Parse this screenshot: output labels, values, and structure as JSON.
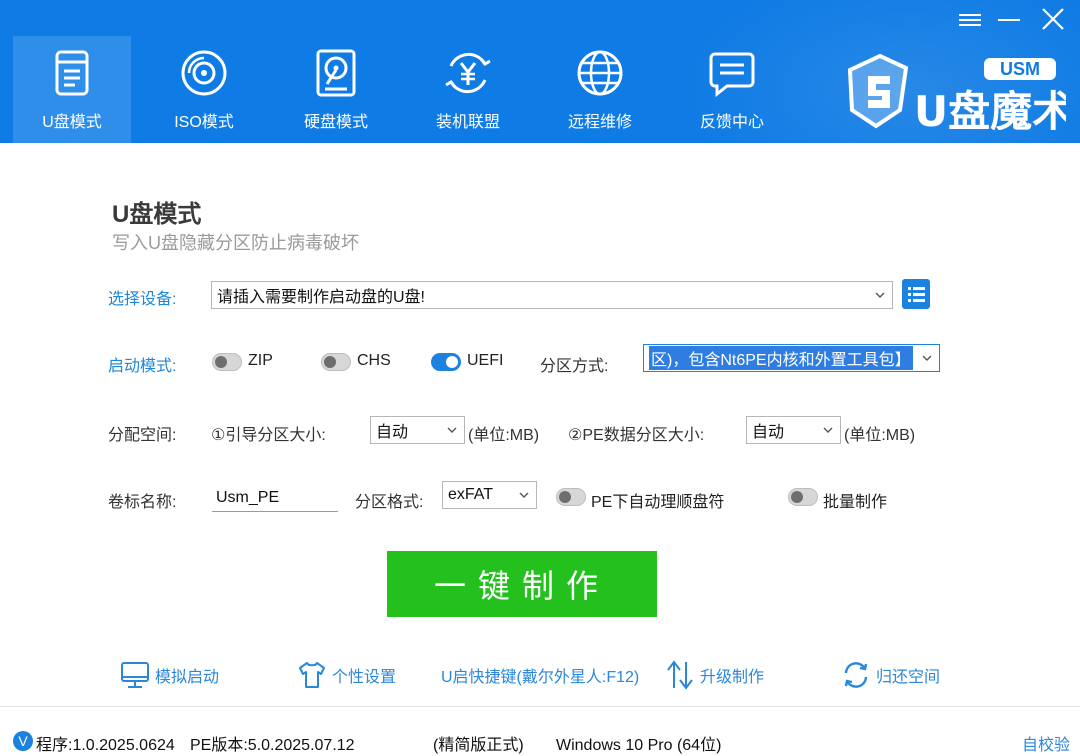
{
  "tabs": [
    {
      "label": "U盘模式",
      "icon": "usb-drive-icon",
      "active": true
    },
    {
      "label": "ISO模式",
      "icon": "disc-icon",
      "active": false
    },
    {
      "label": "硬盘模式",
      "icon": "hard-disk-icon",
      "active": false
    },
    {
      "label": "装机联盟",
      "icon": "yen-coin-icon",
      "active": false
    },
    {
      "label": "远程维修",
      "icon": "globe-icon",
      "active": false
    },
    {
      "label": "反馈中心",
      "icon": "chat-icon",
      "active": false
    }
  ],
  "logo": {
    "brand": "U盘魔术师",
    "badge": "USM"
  },
  "mode": {
    "title": "U盘模式",
    "subtitle": "写入U盘隐藏分区防止病毒破坏"
  },
  "device": {
    "label": "选择设备:",
    "value": "请插入需要制作启动盘的U盘!"
  },
  "boot": {
    "label": "启动模式:",
    "options": [
      {
        "label": "ZIP",
        "on": false
      },
      {
        "label": "CHS",
        "on": false
      },
      {
        "label": "UEFI",
        "on": true
      }
    ],
    "partition_label": "分区方式:",
    "partition_value": "区)，包含Nt6PE内核和外置工具包】"
  },
  "alloc": {
    "label": "分配空间:",
    "boot_size_label": "①引导分区大小:",
    "boot_size_value": "自动",
    "boot_unit": "(单位:MB)",
    "pe_size_label": "②PE数据分区大小:",
    "pe_size_value": "自动",
    "pe_unit": "(单位:MB)"
  },
  "volume": {
    "label": "卷标名称:",
    "value": "Usm_PE",
    "format_label": "分区格式:",
    "format_value": "exFAT",
    "auto_order_label": "PE下自动理顺盘符",
    "auto_order_on": false,
    "batch_label": "批量制作",
    "batch_on": false
  },
  "make_button": "一键制作",
  "tools": [
    {
      "label": "模拟启动",
      "icon": "monitor-icon"
    },
    {
      "label": "个性设置",
      "icon": "tshirt-icon"
    },
    {
      "label": "U启快捷键(戴尔外星人:F12)",
      "icon": ""
    },
    {
      "label": "升级制作",
      "icon": "upgrade-arrows-icon"
    },
    {
      "label": "归还空间",
      "icon": "refresh-icon"
    }
  ],
  "status": {
    "badge": "V",
    "program": "程序:1.0.2025.0624",
    "pe_version": "PE版本:5.0.2025.07.12",
    "edition": "(精简版正式)",
    "os": "Windows 10 Pro (64位)",
    "verify": "自校验"
  },
  "colors": {
    "header": "#0f7be4",
    "accent": "#1c82e0",
    "make_button": "#23c01e",
    "link": "#2b87db"
  }
}
